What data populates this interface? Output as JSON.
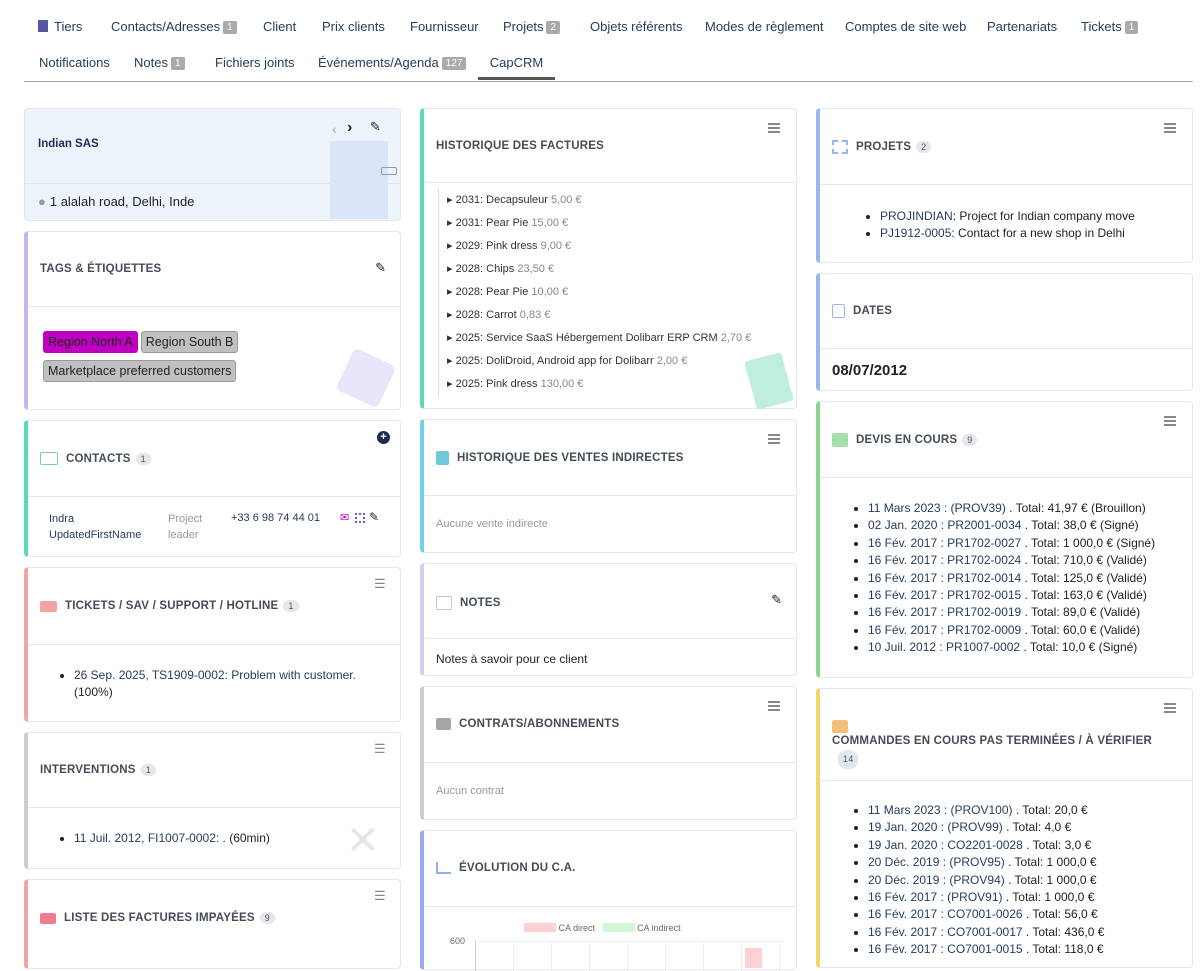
{
  "tabs": [
    {
      "label": "Tiers",
      "badge": ""
    },
    {
      "label": "Contacts/Adresses",
      "badge": "1"
    },
    {
      "label": "Client",
      "badge": ""
    },
    {
      "label": "Prix clients",
      "badge": ""
    },
    {
      "label": "Fournisseur",
      "badge": ""
    },
    {
      "label": "Projets",
      "badge": "2"
    },
    {
      "label": "Objets référents",
      "badge": ""
    },
    {
      "label": "Modes de règlement",
      "badge": ""
    },
    {
      "label": "Comptes de site web",
      "badge": ""
    },
    {
      "label": "Partenariats",
      "badge": ""
    },
    {
      "label": "Tickets",
      "badge": "1"
    },
    {
      "label": "Notifications",
      "badge": ""
    },
    {
      "label": "Notes",
      "badge": "1"
    },
    {
      "label": "Fichiers joints",
      "badge": ""
    },
    {
      "label": "Événements/Agenda",
      "badge": "127"
    },
    {
      "label": "CapCRM",
      "badge": ""
    }
  ],
  "company": {
    "name": "Indian SAS",
    "address": "1 alalah road, Delhi, Inde"
  },
  "tags": {
    "title": "TAGS & ÉTIQUETTES",
    "items": [
      {
        "label": "Region North A",
        "color": "#c000c0"
      },
      {
        "label": "Region South B",
        "color": "#c0c0c0"
      },
      {
        "label": "Marketplace preferred customers",
        "color": "#c0c0c0"
      }
    ]
  },
  "contacts": {
    "title": "CONTACTS",
    "count": "1",
    "name1": "Indra",
    "name2": "UpdatedFirstName",
    "role1": "Project",
    "role2": "leader",
    "phone": "+33 6 98 74 44 01"
  },
  "tickets": {
    "title": "TICKETS / SAV / SUPPORT / HOTLINE",
    "count": "1",
    "item_link": "26 Sep. 2025, TS1909-0002: Problem with customer.",
    "item_rest": "(100%)"
  },
  "interventions": {
    "title": "INTERVENTIONS",
    "count": "1",
    "item_link": "11 Juil. 2012, FI1007-0002: ",
    "item_rest": ". (60min)"
  },
  "unpaid": {
    "title": "LISTE DES FACTURES IMPAYÉES",
    "count": "9"
  },
  "invoices": {
    "title": "HISTORIQUE DES FACTURES",
    "items": [
      {
        "label": "2031: Decapsuleur",
        "amount": "5,00 €"
      },
      {
        "label": "2031: Pear Pie",
        "amount": "15,00 €"
      },
      {
        "label": "2029: Pink dress",
        "amount": "9,00 €"
      },
      {
        "label": "2028: Chips",
        "amount": "23,50 €"
      },
      {
        "label": "2028: Pear Pie",
        "amount": "10,00 €"
      },
      {
        "label": "2028: Carrot",
        "amount": "0,83 €"
      },
      {
        "label": "2025: Service SaaS Hébergement Dolibarr ERP CRM",
        "amount": "2,70 €"
      },
      {
        "label": "2025: DoliDroid, Android app for Dolibarr",
        "amount": "2,00 €"
      },
      {
        "label": "2025: Pink dress",
        "amount": "130,00 €"
      }
    ]
  },
  "indirect": {
    "title": "HISTORIQUE DES VENTES INDIRECTES",
    "empty": "Aucune vente indirecte"
  },
  "notes": {
    "title": "NOTES",
    "text": "Notes à savoir pour ce client"
  },
  "contracts": {
    "title": "CONTRATS/ABONNEMENTS",
    "empty": "Aucun contrat"
  },
  "ca": {
    "title": "ÉVOLUTION DU C.A.",
    "legend_direct": "CA direct",
    "legend_indirect": "CA indirect",
    "y_tick": "600"
  },
  "chart_data": {
    "type": "bar",
    "series": [
      {
        "name": "CA direct"
      },
      {
        "name": "CA indirect"
      }
    ],
    "yticks": [
      "600"
    ]
  },
  "projects": {
    "title": "PROJETS",
    "count": "2",
    "items": [
      {
        "ref": "PROJINDIAN",
        "text": ": Project for Indian company move"
      },
      {
        "ref": "PJ1912-0005",
        "text": ": Contact for a new shop in Delhi"
      }
    ]
  },
  "dates": {
    "title": "DATES",
    "value": "08/07/2012"
  },
  "quotes": {
    "title": "DEVIS EN COURS",
    "count": "9",
    "items": [
      {
        "link": "11 Mars 2023 : (PROV39)",
        "rest": " . Total: 41,97 € (Brouillon)"
      },
      {
        "link": "02 Jan. 2020 : PR2001-0034",
        "rest": " . Total: 38,0 € (Signé)"
      },
      {
        "link": "16 Fév. 2017 : PR1702-0027",
        "rest": " . Total: 1 000,0 € (Signé)"
      },
      {
        "link": "16 Fév. 2017 : PR1702-0024",
        "rest": " . Total: 710,0 € (Validé)"
      },
      {
        "link": "16 Fév. 2017 : PR1702-0014",
        "rest": " . Total: 125,0 € (Validé)"
      },
      {
        "link": "16 Fév. 2017 : PR1702-0015",
        "rest": " . Total: 163,0 € (Validé)"
      },
      {
        "link": "16 Fév. 2017 : PR1702-0019",
        "rest": " . Total: 89,0 € (Validé)"
      },
      {
        "link": "16 Fév. 2017 : PR1702-0009",
        "rest": " . Total: 60,0 € (Validé)"
      },
      {
        "link": "10 Juil. 2012 : PR1007-0002",
        "rest": " . Total: 10,0 € (Signé)"
      }
    ]
  },
  "orders": {
    "title": "COMMANDES EN COURS PAS TERMINÉES / À VÉRIFIER",
    "count": "14",
    "items": [
      {
        "link": "11 Mars 2023 : (PROV100)",
        "rest": " . Total: 20,0 €"
      },
      {
        "link": "19 Jan. 2020 : (PROV99)",
        "rest": " . Total: 4,0 €"
      },
      {
        "link": "19 Jan. 2020 : CO2201-0028",
        "rest": " . Total: 3,0 €"
      },
      {
        "link": "20 Déc. 2019 : (PROV95)",
        "rest": " . Total: 1 000,0 €"
      },
      {
        "link": "20 Déc. 2019 : (PROV94)",
        "rest": " . Total: 1 000,0 €"
      },
      {
        "link": "16 Fév. 2017 : (PROV91)",
        "rest": " . Total: 1 000,0 €"
      },
      {
        "link": "16 Fév. 2017 : CO7001-0026",
        "rest": " . Total: 56,0 €"
      },
      {
        "link": "16 Fév. 2017 : CO7001-0017",
        "rest": " . Total: 436,0 €"
      },
      {
        "link": "16 Fév. 2017 : CO7001-0015",
        "rest": " . Total: 118,0 €"
      }
    ]
  }
}
